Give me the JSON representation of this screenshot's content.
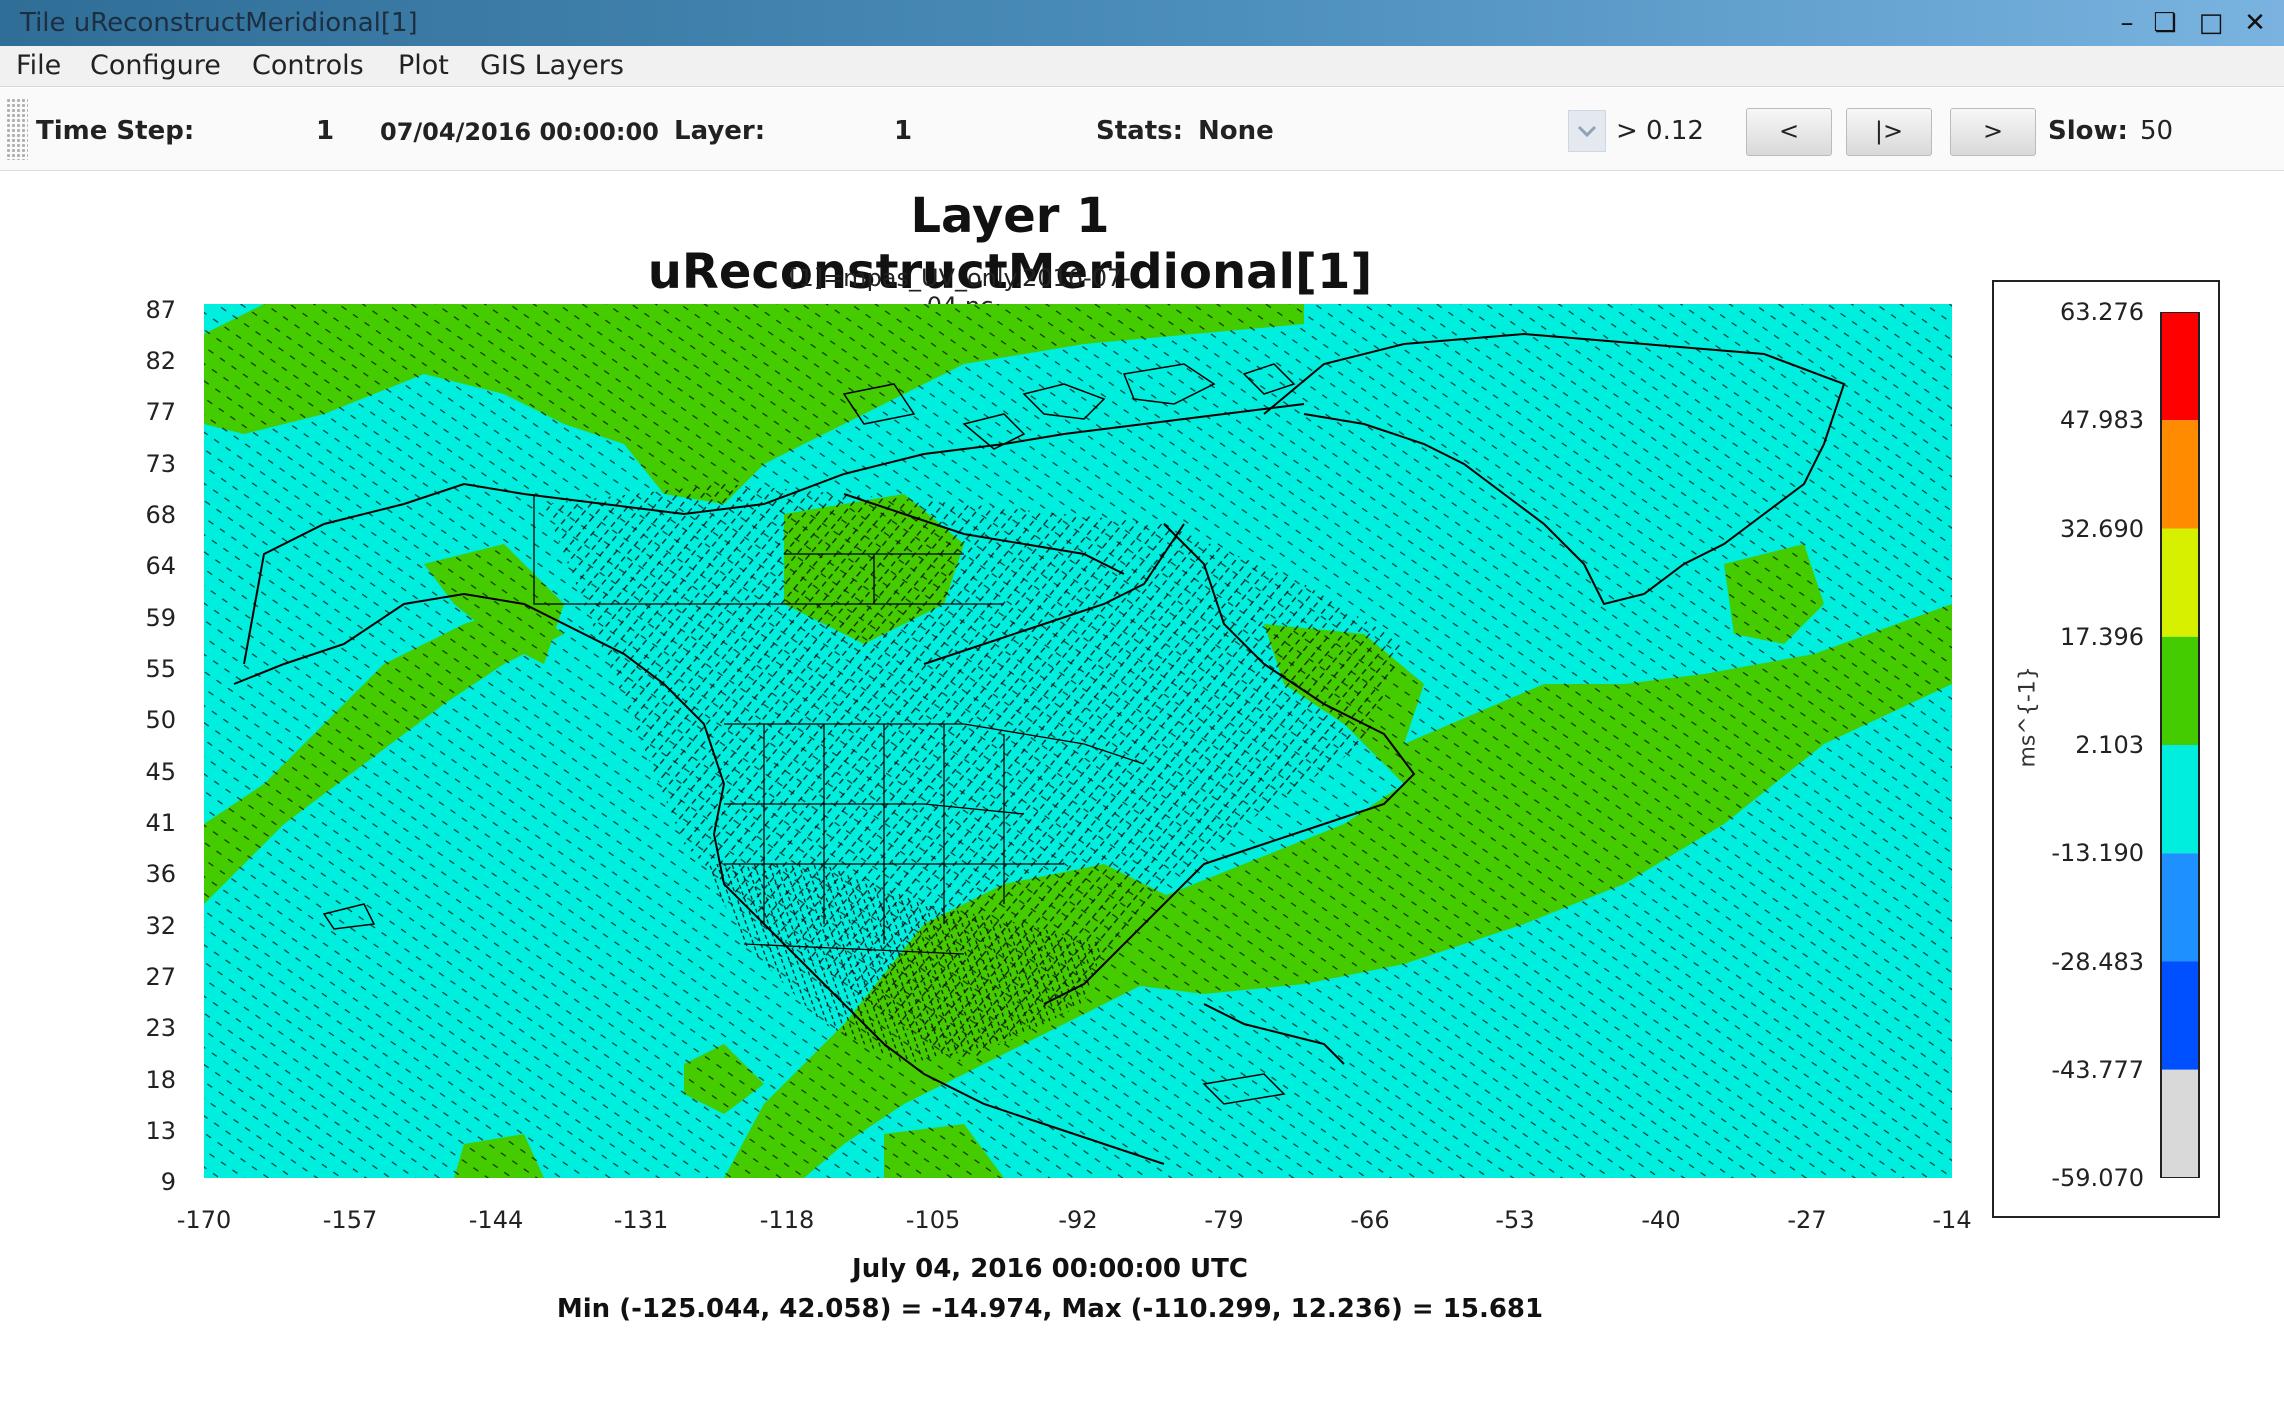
{
  "window": {
    "title": "Tile uReconstructMeridional[1]"
  },
  "menu": [
    "File",
    "Configure",
    "Controls",
    "Plot",
    "GIS Layers"
  ],
  "toolbar": {
    "time_step_label": "Time Step:",
    "time_step_value": "1",
    "datetime": "07/04/2016 00:00:00",
    "layer_label": "Layer:",
    "layer_value": "1",
    "stats_label": "Stats:",
    "stats_value": "None",
    "threshold": "> 0.12",
    "btn_prev": "<",
    "btn_play": "|>",
    "btn_next": ">",
    "slow_label": "Slow:",
    "slow_value": "50"
  },
  "plot": {
    "title": "Layer 1 uReconstructMeridional[1]",
    "subtitle": "[1]=mpas_UV_only.2016-07-04.nc",
    "footer_time": "July 04, 2016 00:00:00 UTC",
    "footer_stats": "Min (-125.044, 42.058) = -14.974, Max (-110.299, 12.236) = 15.681"
  },
  "chart_data": {
    "type": "heatmap",
    "title": "Layer 1 uReconstructMeridional[1]",
    "subtitle": "[1]=mpas_UV_only.2016-07-04.nc",
    "x_ticks": [
      "-170",
      "-157",
      "-144",
      "-131",
      "-118",
      "-105",
      "-92",
      "-79",
      "-66",
      "-53",
      "-40",
      "-27",
      "-14"
    ],
    "y_ticks": [
      "87",
      "82",
      "77",
      "73",
      "68",
      "64",
      "59",
      "55",
      "50",
      "45",
      "41",
      "36",
      "32",
      "27",
      "23",
      "18",
      "13",
      "9"
    ],
    "xlim": [
      -170,
      -14
    ],
    "ylim": [
      9,
      87
    ],
    "legend": {
      "unit": "ms^{-1}",
      "values": [
        "63.276",
        "47.983",
        "32.690",
        "17.396",
        "2.103",
        "-13.190",
        "-28.483",
        "-43.777",
        "-59.070"
      ],
      "colors": [
        "#ff0000",
        "#ff8c00",
        "#d7f000",
        "#44cc00",
        "#00eedd",
        "#1e90ff",
        "#0050ff",
        "#d9d9d9"
      ]
    },
    "background_color": "#00eedd",
    "overlay_color": "#44cc00"
  }
}
